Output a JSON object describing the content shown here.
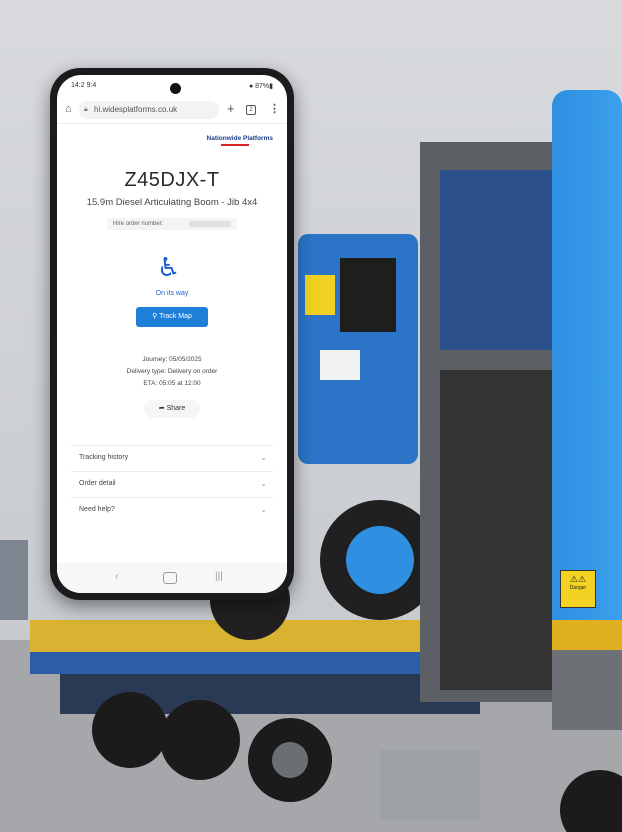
{
  "browser": {
    "url": "hi.widesplatforms.co.uk",
    "status_time": "14:2 9:4",
    "status_right": "● 87%▮"
  },
  "icons": {
    "home": "home-icon",
    "lock": "lock-icon",
    "plus": "plus-icon",
    "tabs": "tabs-icon",
    "menu": "menu-icon",
    "truck": "wheelchair-truck-icon",
    "share": "share-icon",
    "chevron": "chevron-down-icon"
  },
  "page": {
    "brand": "Nationwide Platforms",
    "title": "Z45DJX-T",
    "subtitle": "15.9m Diesel Articulating Boom - Jib 4x4",
    "hire_label": "Hire order number:",
    "status": "On its way",
    "track_button": "Track Map",
    "journey": "Journey: 05/05/2025",
    "delivery": "Delivery type: Delivery on order",
    "eta": "ETA: 05:05 at 12:00",
    "share_button": "Share",
    "accordions": [
      {
        "label": "Tracking history"
      },
      {
        "label": "Order detail"
      },
      {
        "label": "Need help?"
      }
    ]
  },
  "vehicle": {
    "warning_text": "Danger"
  },
  "colors": {
    "accent_blue": "#1e7fd9",
    "truck_blue": "#2f8fe0",
    "bed_yellow": "#d8b230"
  }
}
